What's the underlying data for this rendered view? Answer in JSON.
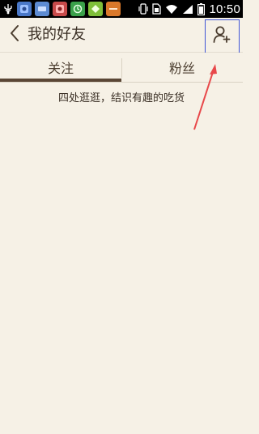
{
  "status_bar": {
    "time": "10:50",
    "icons": [
      "usb-icon",
      "app-icon",
      "app-icon",
      "app-icon",
      "app-icon",
      "app-icon",
      "app-icon",
      "vibrate-icon",
      "sim-icon",
      "wifi-icon",
      "signal-icon",
      "battery-icon"
    ]
  },
  "header": {
    "title": "我的好友",
    "back_icon": "chevron-left-icon",
    "add_friend_icon": "add-person-icon"
  },
  "tabs": [
    {
      "label": "关注",
      "active": true
    },
    {
      "label": "粉丝",
      "active": false
    }
  ],
  "content": {
    "empty_hint": "四处逛逛，结识有趣的吃货"
  },
  "colors": {
    "background": "#f6f1e6",
    "text": "#3a2f25",
    "tab_indicator": "#5a4635",
    "highlight_box": "#3f55d6",
    "arrow": "#e8484a"
  }
}
